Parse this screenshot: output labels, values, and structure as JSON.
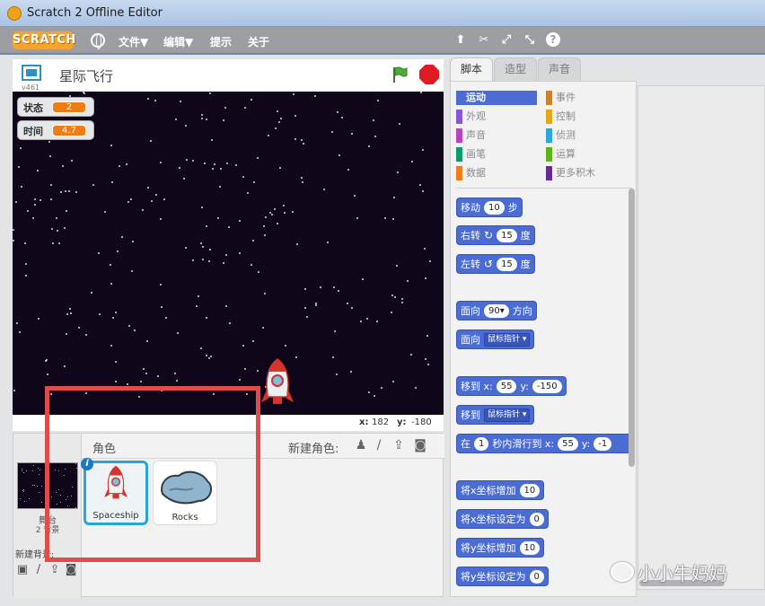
{
  "window": {
    "title": "Scratch 2 Offline Editor"
  },
  "menubar": {
    "logo": "SCRATCH",
    "items": [
      "文件▼",
      "编辑▼",
      "提示",
      "关于"
    ],
    "tools": [
      "duplicate-icon",
      "delete-icon",
      "grow-icon",
      "shrink-icon",
      "help-icon"
    ],
    "help_label": "?"
  },
  "stage": {
    "version": "v461",
    "project_title": "星际飞行",
    "monitors": [
      {
        "label": "状态",
        "value": "2"
      },
      {
        "label": "时间",
        "value": "4.7"
      }
    ],
    "coords": {
      "x_label": "x:",
      "x": "182",
      "y_label": "y:",
      "y": "-180"
    }
  },
  "sprites": {
    "header_label": "角色",
    "new_sprite_label": "新建角色:",
    "stage_label": "舞台",
    "stage_sub": "2 背景",
    "new_bg_label": "新建背景:",
    "items": [
      {
        "name": "Spaceship",
        "selected": true
      },
      {
        "name": "Rocks",
        "selected": false
      }
    ]
  },
  "tabs": [
    "脚本",
    "造型",
    "声音"
  ],
  "categories": {
    "left": [
      {
        "label": "运动",
        "color": "#4a6cd4",
        "active": true
      },
      {
        "label": "外观",
        "color": "#8a55d7"
      },
      {
        "label": "声音",
        "color": "#bb42c3"
      },
      {
        "label": "画笔",
        "color": "#0e9a6c"
      },
      {
        "label": "数据",
        "color": "#ee7d16"
      }
    ],
    "right": [
      {
        "label": "事件",
        "color": "#c88330"
      },
      {
        "label": "控制",
        "color": "#e1a91a"
      },
      {
        "label": "侦测",
        "color": "#2ca5e2"
      },
      {
        "label": "运算",
        "color": "#5cb712"
      },
      {
        "label": "更多积木",
        "color": "#632d99"
      }
    ]
  },
  "blocks": {
    "move": {
      "a": "移动",
      "n": "10",
      "b": "步"
    },
    "turn_right": {
      "a": "右转",
      "n": "15",
      "b": "度"
    },
    "turn_left": {
      "a": "左转",
      "n": "15",
      "b": "度"
    },
    "point_dir": {
      "a": "面向",
      "n": "90▾",
      "b": "方向"
    },
    "point_towards": {
      "a": "面向",
      "d": "鼠标指针 ▾"
    },
    "goto_xy": {
      "a": "移到 x:",
      "x": "55",
      "b": "y:",
      "y": "-150"
    },
    "goto": {
      "a": "移到",
      "d": "鼠标指针 ▾"
    },
    "glide": {
      "a": "在",
      "n": "1",
      "b": "秒内滑行到 x:",
      "x": "55",
      "c": "y:",
      "y": "-1"
    },
    "change_x": {
      "a": "将x坐标增加",
      "n": "10"
    },
    "set_x": {
      "a": "将x坐标设定为",
      "n": "0"
    },
    "change_y": {
      "a": "将y坐标增加",
      "n": "10"
    },
    "set_y": {
      "a": "将y坐标设定为",
      "n": "0"
    }
  },
  "watermark": "小小牛妈妈"
}
